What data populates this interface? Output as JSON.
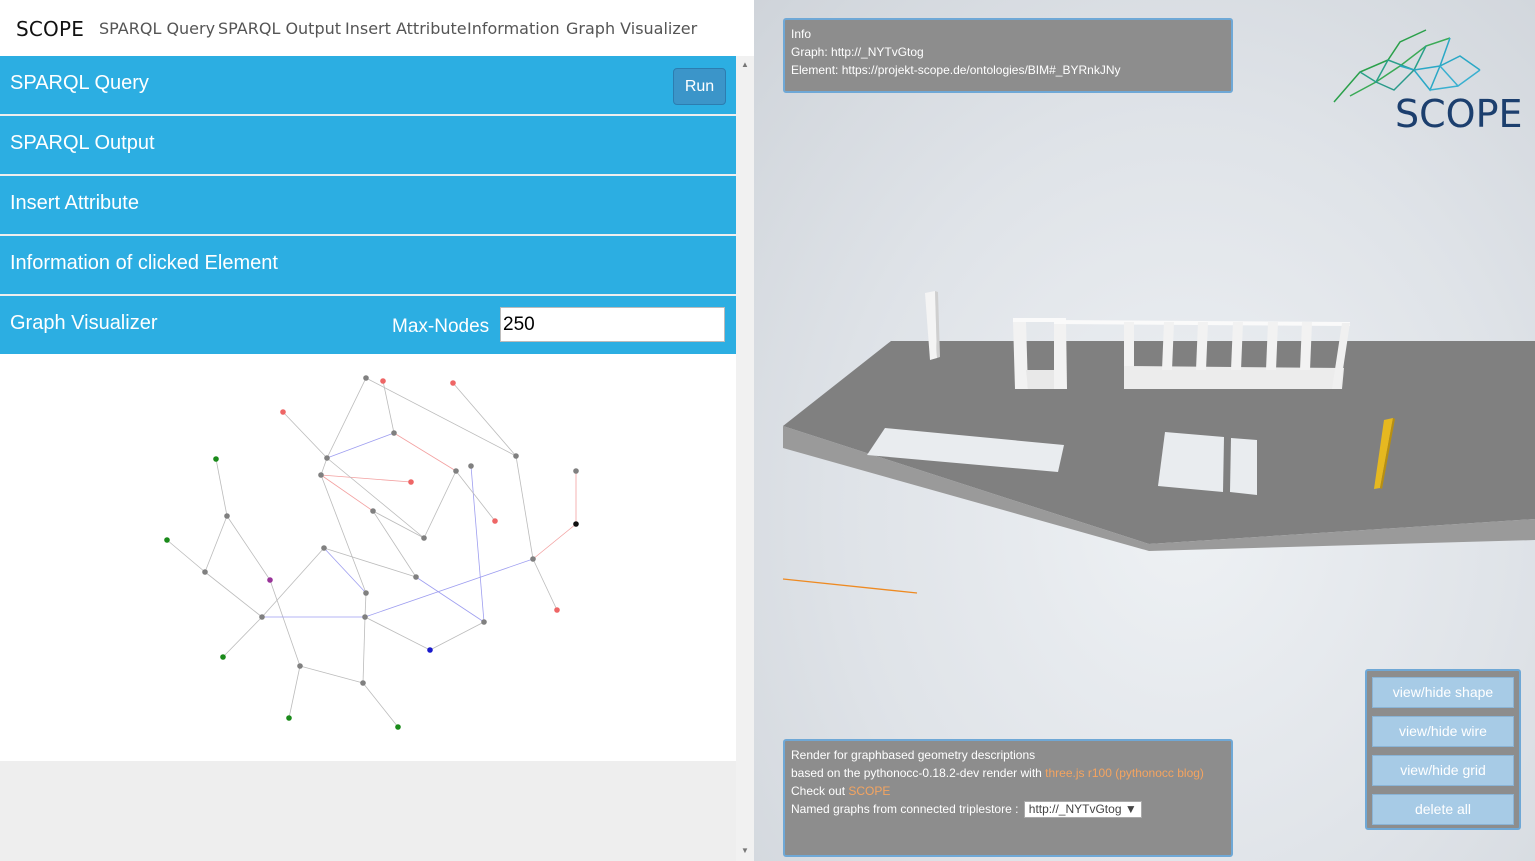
{
  "navbar": {
    "brand": "SCOPE",
    "links": [
      "SPARQL Query",
      "SPARQL Output",
      "Insert Attribute",
      "Information",
      "Graph Visualizer"
    ]
  },
  "panels": {
    "sparql_query": {
      "title": "SPARQL Query",
      "run_label": "Run"
    },
    "sparql_output": {
      "title": "SPARQL Output"
    },
    "insert_attribute": {
      "title": "Insert Attribute"
    },
    "information": {
      "title": "Information of clicked Element"
    },
    "graph_visualizer": {
      "title": "Graph Visualizer",
      "max_nodes_label": "Max-Nodes",
      "max_nodes_value": "250"
    }
  },
  "graph": {
    "edge_colors": {
      "gray": "#bbbbbb",
      "blue": "#9e9ef0",
      "red": "#f3a0a0"
    },
    "node_colors": {
      "gray": "#808080",
      "red": "#ee6666",
      "green": "#1a8a1a",
      "purple": "#993399",
      "blue": "#1a1acc",
      "black": "#111111"
    }
  },
  "info_top": {
    "title": "Info",
    "graph": "Graph: http://_NYTvGtog",
    "element": "Element: https://projekt-scope.de/ontologies/BIM#_BYRnkJNy"
  },
  "info_bottom": {
    "line1": "Render for graphbased geometry descriptions",
    "line2_prefix": "based on the pythonocc-0.18.2-dev render with ",
    "line2_link": "three.js r100 (pythonocc blog)",
    "line3_prefix": "Check out ",
    "line3_link": "SCOPE",
    "line4_prefix": "Named graphs from connected triplestore : ",
    "select_value": "http://_NYTvGtog ▼"
  },
  "controls": {
    "shape": "view/hide shape",
    "wire": "view/hide wire",
    "grid": "view/hide grid",
    "delete": "delete all"
  },
  "logo": {
    "text": "SCOPE"
  },
  "colors": {
    "panel": "#2caee2",
    "run_button": "#3b95c9",
    "info_box": "#8d8d8d",
    "info_border": "#6fa8d6",
    "link": "#f4a460",
    "control_button": "#a7cbe6",
    "slab": "#808080",
    "wall": "#f0f0f0",
    "column": "#e6b820",
    "logo_text": "#1c3f6e"
  }
}
